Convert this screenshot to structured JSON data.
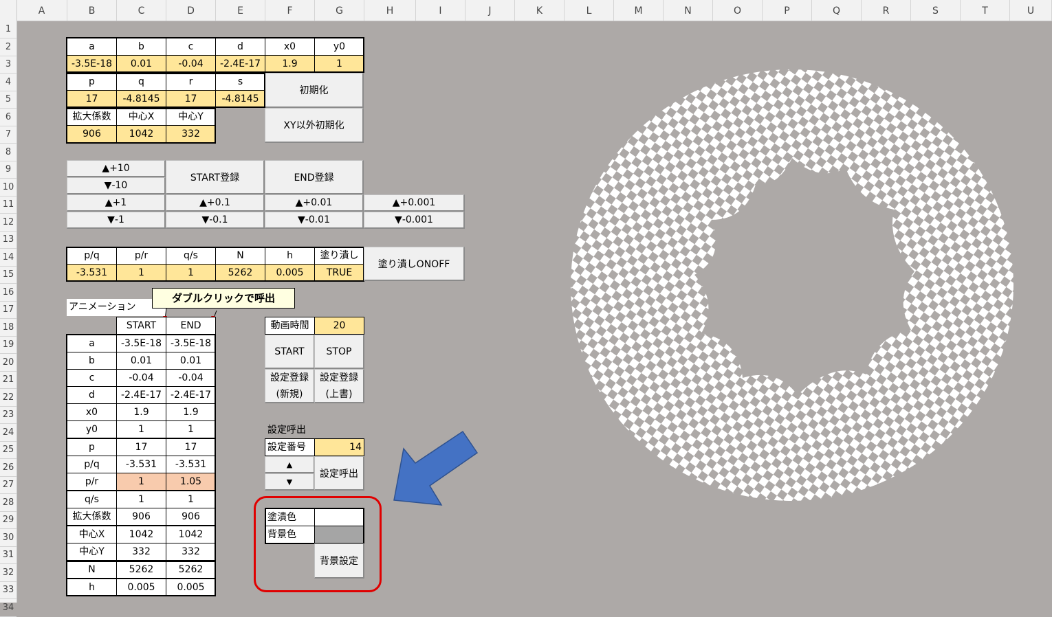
{
  "columns": [
    "A",
    "B",
    "C",
    "D",
    "E",
    "F",
    "G",
    "H",
    "I",
    "J",
    "K",
    "L",
    "M",
    "N",
    "O",
    "P",
    "Q",
    "R",
    "S",
    "T",
    "U"
  ],
  "rows": [
    "1",
    "2",
    "3",
    "4",
    "5",
    "6",
    "7",
    "8",
    "9",
    "10",
    "11",
    "12",
    "13",
    "14",
    "15",
    "16",
    "17",
    "18",
    "19",
    "20",
    "21",
    "22",
    "23",
    "24",
    "25",
    "26",
    "27",
    "28",
    "29",
    "30",
    "31",
    "32",
    "33",
    "34"
  ],
  "params": {
    "h1": [
      "a",
      "b",
      "c",
      "d",
      "x0",
      "y0"
    ],
    "v1": [
      "-3.5E-18",
      "0.01",
      "-0.04",
      "-2.4E-17",
      "1.9",
      "1"
    ],
    "h2": [
      "p",
      "q",
      "r",
      "s"
    ],
    "v2": [
      "17",
      "-4.8145",
      "17",
      "-4.8145"
    ],
    "h3": [
      "拡大係数",
      "中心X",
      "中心Y"
    ],
    "v3": [
      "906",
      "1042",
      "332"
    ],
    "init_btn": "初期化",
    "init_xy_btn": "XY以外初期化"
  },
  "steps": {
    "up10": "▲+10",
    "down10": "▼-10",
    "start_reg": "START登録",
    "end_reg": "END登録",
    "up1": "▲+1",
    "up01": "▲+0.1",
    "up001": "▲+0.01",
    "up0001": "▲+0.001",
    "down1": "▼-1",
    "down01": "▼-0.1",
    "down001": "▼-0.01",
    "down0001": "▼-0.001"
  },
  "ratios": {
    "headers": [
      "p/q",
      "p/r",
      "q/s",
      "N",
      "h",
      "塗り潰し"
    ],
    "values": [
      "-3.531",
      "1",
      "1",
      "5262",
      "0.005",
      "TRUE"
    ],
    "fill_btn": "塗り潰しONOFF"
  },
  "animation": {
    "title": "アニメーション",
    "tooltip": "ダブルクリックで呼出",
    "col_start": "START",
    "col_end": "END",
    "rows": [
      {
        "name": "a",
        "start": "-3.5E-18",
        "end": "-3.5E-18"
      },
      {
        "name": "b",
        "start": "0.01",
        "end": "0.01"
      },
      {
        "name": "c",
        "start": "-0.04",
        "end": "-0.04"
      },
      {
        "name": "d",
        "start": "-2.4E-17",
        "end": "-2.4E-17"
      },
      {
        "name": "x0",
        "start": "1.9",
        "end": "1.9"
      },
      {
        "name": "y0",
        "start": "1",
        "end": "1"
      },
      {
        "name": "p",
        "start": "17",
        "end": "17"
      },
      {
        "name": "p/q",
        "start": "-3.531",
        "end": "-3.531"
      },
      {
        "name": "p/r",
        "start": "1",
        "end": "1.05"
      },
      {
        "name": "q/s",
        "start": "1",
        "end": "1"
      },
      {
        "name": "拡大係数",
        "start": "906",
        "end": "906"
      },
      {
        "name": "中心X",
        "start": "1042",
        "end": "1042"
      },
      {
        "name": "中心Y",
        "start": "332",
        "end": "332"
      },
      {
        "name": "N",
        "start": "5262",
        "end": "5262"
      },
      {
        "name": "h",
        "start": "0.005",
        "end": "0.005"
      }
    ]
  },
  "controls": {
    "duration_label": "動画時間",
    "duration_value": "20",
    "start_btn": "START",
    "stop_btn": "STOP",
    "save_new_1": "設定登録",
    "save_new_2": "(新規)",
    "save_over_1": "設定登録",
    "save_over_2": "(上書)",
    "recall_title": "設定呼出",
    "setting_no_label": "設定番号",
    "setting_no_value": "14",
    "up_arrow": "▲",
    "down_arrow": "▼",
    "recall_btn": "設定呼出",
    "fill_color_label": "塗潰色",
    "bg_color_label": "背景色",
    "bg_set_btn": "背景設定"
  },
  "colors": {
    "sheet_bg": "#ada9a7",
    "yellow": "#ffe699",
    "pink": "#f8cbad",
    "arrow_blue": "#4472c4",
    "highlight_red": "#e00000"
  }
}
